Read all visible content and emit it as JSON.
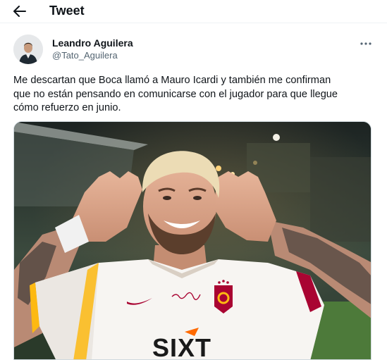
{
  "header": {
    "back_icon": "arrow-left-icon",
    "title": "Tweet"
  },
  "tweet": {
    "author": {
      "name": "Leandro Aguilera",
      "handle": "@Tato_Aguilera",
      "avatar_icon": "user-avatar"
    },
    "more_icon": "more-horizontal-icon",
    "text_lines": [
      "Me descartan que Boca llamó a Mauro Icardi y también me confirman",
      "que no están pensando en comunicarse con el jugador para que llegue",
      "cómo refuerzo en junio."
    ],
    "media": {
      "kind": "photo",
      "jersey_sponsor": "SIXT"
    }
  },
  "colors": {
    "text_primary": "#0f1419",
    "text_secondary": "#536471",
    "divider": "#eff3f4",
    "galatasaray_red": "#a90432",
    "galatasaray_orange": "#fdb912"
  }
}
